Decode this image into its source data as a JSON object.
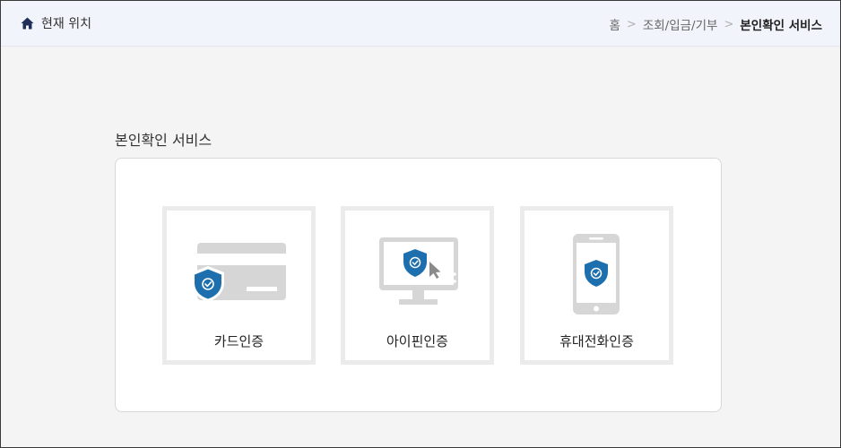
{
  "header": {
    "location_label": "현재 위치",
    "breadcrumb": [
      "홈",
      "조회/입금/기부",
      "본인확인 서비스"
    ]
  },
  "section": {
    "title": "본인확인 서비스"
  },
  "cards": [
    {
      "label": "카드인증",
      "icon": "card-shield-icon"
    },
    {
      "label": "아이핀인증",
      "icon": "monitor-shield-icon"
    },
    {
      "label": "휴대전화인증",
      "icon": "phone-shield-icon"
    }
  ],
  "colors": {
    "shield_blue": "#1e6fad",
    "shield_border": "#ffffff",
    "icon_gray": "#d6d6d6",
    "card_border": "#ebebeb"
  }
}
